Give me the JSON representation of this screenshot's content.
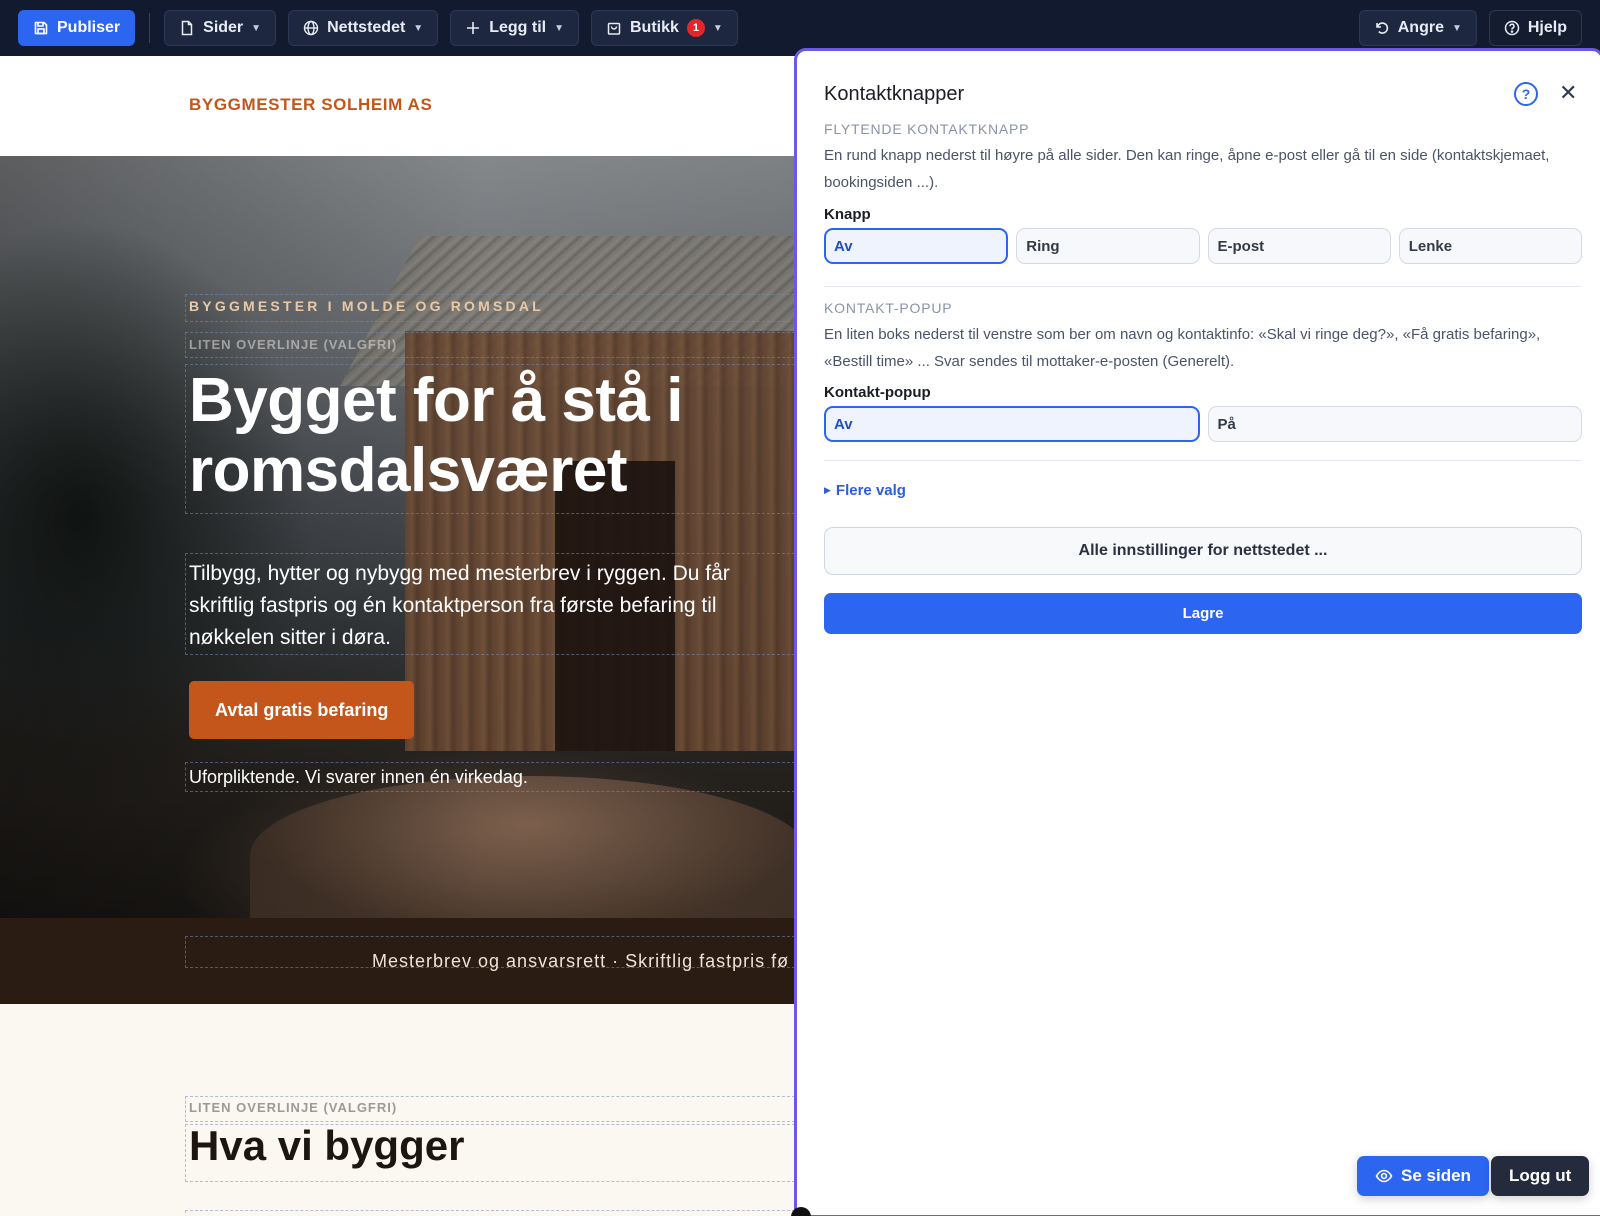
{
  "toolbar": {
    "publish_label": "Publiser",
    "pages_label": "Sider",
    "site_label": "Nettstedet",
    "add_label": "Legg til",
    "shop_label": "Butikk",
    "shop_badge": "1",
    "undo_label": "Angre",
    "help_label": "Hjelp",
    "bg_color": "#111a2e",
    "accent": "#2c66f0"
  },
  "preview": {
    "brand": "BYGGMESTER SOLHEIM AS",
    "brand_color": "#c4561c",
    "hero": {
      "eyebrow": "BYGGMESTER I MOLDE OG ROMSDAL",
      "overline_placeholder": "LITEN OVERLINJE (VALGFRI)",
      "title": "Bygget for å stå i romsdalsværet",
      "subtitle": "Tilbygg, hytter og nybygg med mesterbrev i ryggen. Du får skriftlig fastpris og én kontaktperson fra første befaring til nøkkelen sitter i døra.",
      "cta_label": "Avtal gratis befaring",
      "note": "Uforpliktende. Vi svarer innen én virkedag."
    },
    "ticker": "Mesterbrev og ansvarsrett  ·  Skriftlig fastpris fø",
    "section2": {
      "overline_placeholder": "LITEN OVERLINJE (VALGFRI)",
      "title": "Hva vi bygger"
    }
  },
  "panel": {
    "title": "Kontaktknapper",
    "help_icon_text": "?",
    "close_icon_text": "✕",
    "floating": {
      "section_title": "FLYTENDE KONTAKTKNAPP",
      "description": "En rund knapp nederst til høyre på alle sider. Den kan ringe, åpne e-post eller gå til en side (kontaktskjemaet, bookingsiden ...).",
      "field_label": "Knapp",
      "options": [
        "Av",
        "Ring",
        "E-post",
        "Lenke"
      ],
      "selected": "Av"
    },
    "popup": {
      "section_title": "KONTAKT-POPUP",
      "description": "En liten boks nederst til venstre som ber om navn og kontaktinfo: «Skal vi ringe deg?», «Få gratis befaring», «Bestill time» ... Svar sendes til mottaker-e-posten (Generelt).",
      "field_label": "Kontakt-popup",
      "options": [
        "Av",
        "På"
      ],
      "selected": "Av"
    },
    "more_options": "Flere valg",
    "all_settings": "Alle innstillinger for nettstedet ...",
    "save_label": "Lagre",
    "border_color": "#6b58e6"
  },
  "floating_buttons": {
    "view_label": "Se siden",
    "logout_label": "Logg ut"
  }
}
